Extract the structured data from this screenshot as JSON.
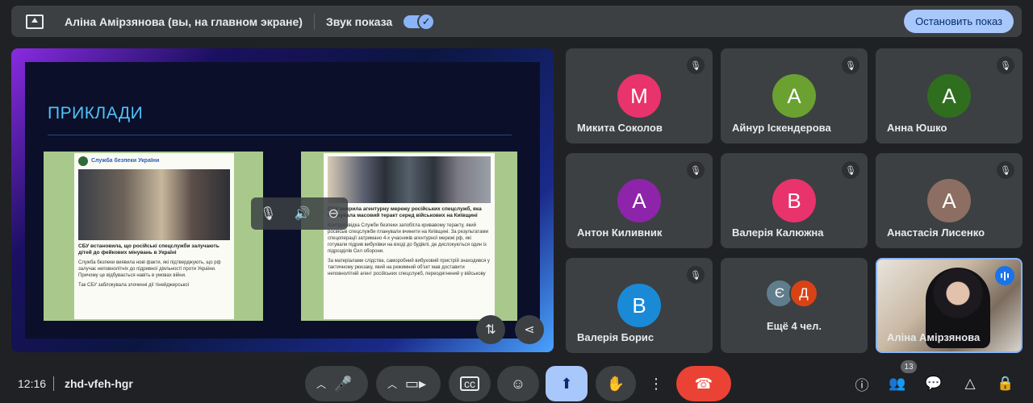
{
  "banner": {
    "presenter_text": "Аліна Амірзянова (вы, на главном экране)",
    "sound_label": "Звук показа",
    "sound_enabled": true,
    "stop_label": "Остановить показ"
  },
  "slide": {
    "title": "ПРИКЛАДИ",
    "card1": {
      "source": "Служба безпеки України",
      "headline": "СБУ встановила, що російські спецслужби залучають дітей до фейкових мінувань в Україні",
      "para1": "Служба безпеки виявила нові факти, які підтверджують, що рф залучає неповнолітніх до підривної діяльності проти України. Причому це відбувається навіть в умовах війни.",
      "para2": "Так СБУ заблокувала злочинні дії тінейджерської"
    },
    "card2": {
      "headline": "СБУ викрила агентурну мережу російських спецслужб, яка планувала масовий теракт серед військових на Київщині",
      "para1": "Контррозвідка Служби безпеки запобігла кривавому теракту, який російські спецслужби планували вчинити на Київщині. За результатами спецоперації затримано 4-х учасників агентурної мережі рф, які готували підрив вибухівки на вході до будівлі, де дислокуються один із підрозділів Сил оборони.",
      "para2": "За матеріалами слідства, саморобний вибуховий пристрій знаходився у тактичному рюкзаку, який на режимний об'єкт мав доставити неповнолітній агент російських спецслужб, переодягнений у військову"
    }
  },
  "participants": [
    {
      "name": "Микита Соколов",
      "initial": "М",
      "color": "#e8336d"
    },
    {
      "name": "Айнур Іскендерова",
      "initial": "А",
      "color": "#6aa130"
    },
    {
      "name": "Анна Юшко",
      "initial": "А",
      "color": "#2f6e1f"
    },
    {
      "name": "Антон Киливник",
      "initial": "А",
      "color": "#8e24aa"
    },
    {
      "name": "Валерія Калюжна",
      "initial": "В",
      "color": "#e8336d"
    },
    {
      "name": "Анастасія Лисенко",
      "initial": "А",
      "color": "#8d6e63"
    },
    {
      "name": "Валерія Борис",
      "initial": "В",
      "color": "#1a8ad6"
    }
  ],
  "more_tile": {
    "initials": [
      "Є",
      "Д"
    ],
    "colors": [
      "#607d8b",
      "#d84315"
    ],
    "label": "Ещё 4 чел."
  },
  "self_tile": {
    "name": "Аліна Амірзянова"
  },
  "bottom": {
    "time": "12:16",
    "meeting_code": "zhd-vfeh-hgr",
    "participants_count": "13"
  }
}
